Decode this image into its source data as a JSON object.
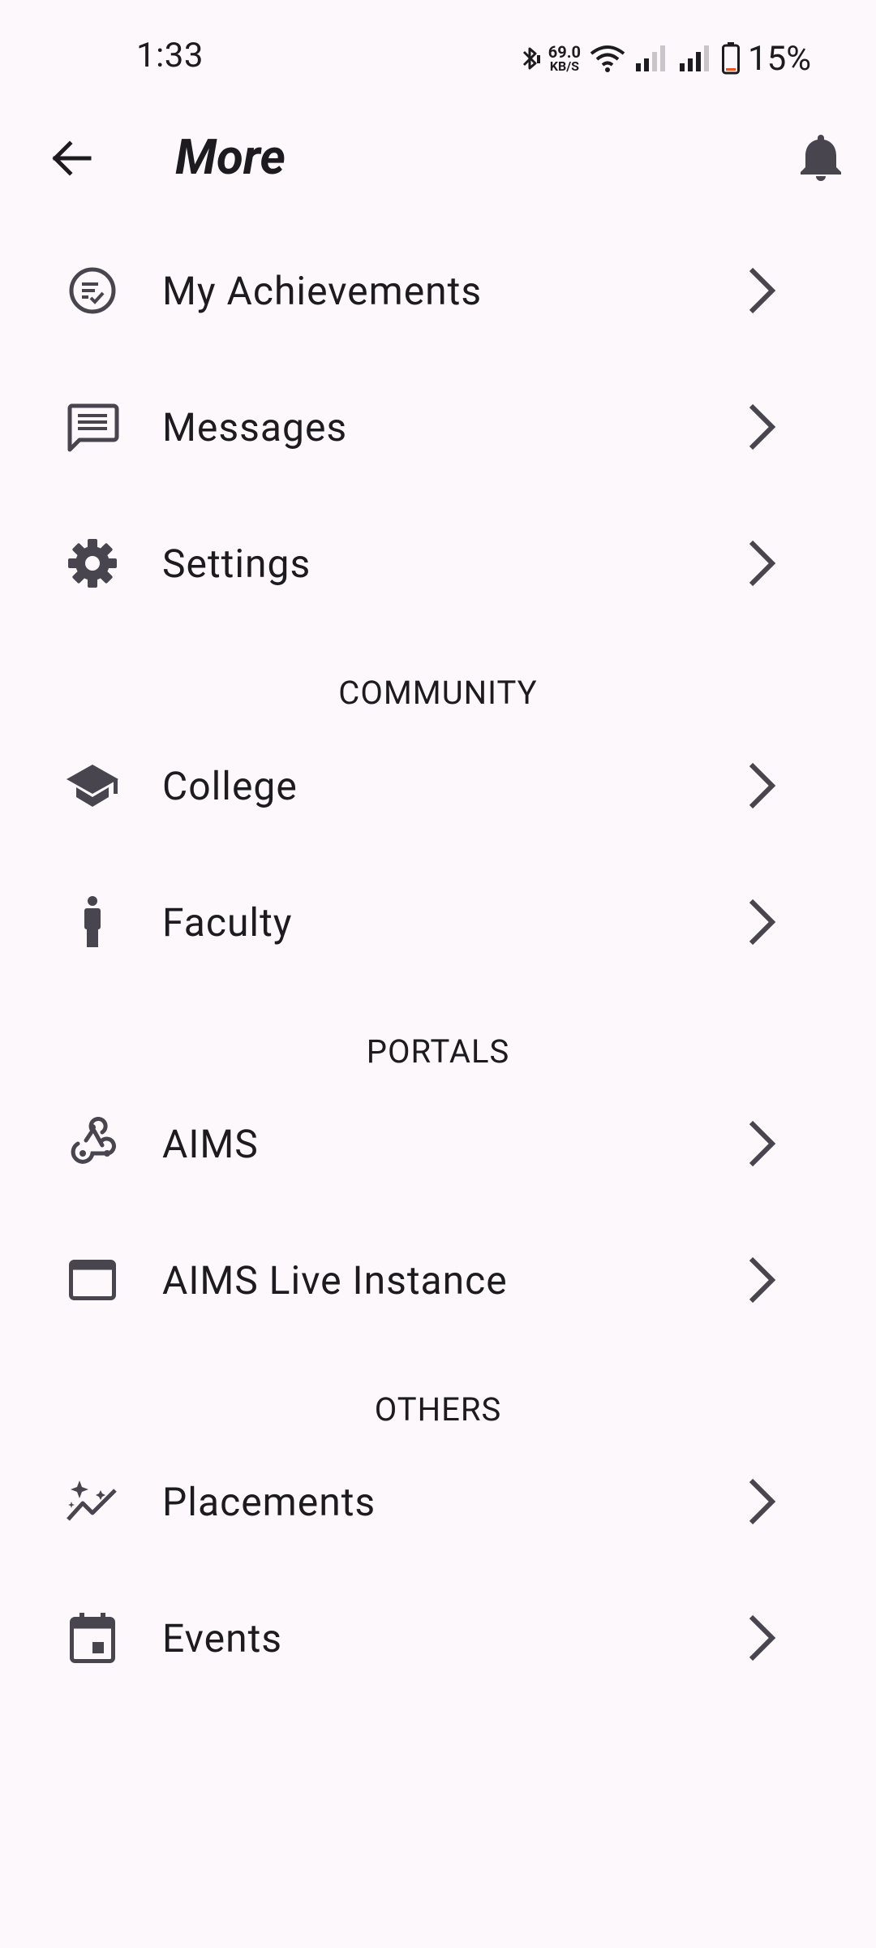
{
  "status_bar": {
    "time": "1:33",
    "net_speed_value": "69.0",
    "net_speed_unit": "KB/S",
    "battery": "15%"
  },
  "app_bar": {
    "title": "More"
  },
  "menu": {
    "items": [
      {
        "label": "My Achievements",
        "icon": "achievements-icon"
      },
      {
        "label": "Messages",
        "icon": "messages-icon"
      },
      {
        "label": "Settings",
        "icon": "settings-icon"
      }
    ],
    "sections": [
      {
        "header": "COMMUNITY",
        "items": [
          {
            "label": "College",
            "icon": "graduation-cap-icon"
          },
          {
            "label": "Faculty",
            "icon": "person-icon"
          }
        ]
      },
      {
        "header": "PORTALS",
        "items": [
          {
            "label": "AIMS",
            "icon": "webhook-icon"
          },
          {
            "label": "AIMS Live Instance",
            "icon": "browser-window-icon"
          }
        ]
      },
      {
        "header": "OTHERS",
        "items": [
          {
            "label": "Placements",
            "icon": "insights-icon"
          },
          {
            "label": "Events",
            "icon": "calendar-event-icon"
          }
        ]
      }
    ]
  },
  "colors": {
    "background": "#fdf8fc",
    "icon": "#49454f",
    "text": "#1d1b20"
  }
}
